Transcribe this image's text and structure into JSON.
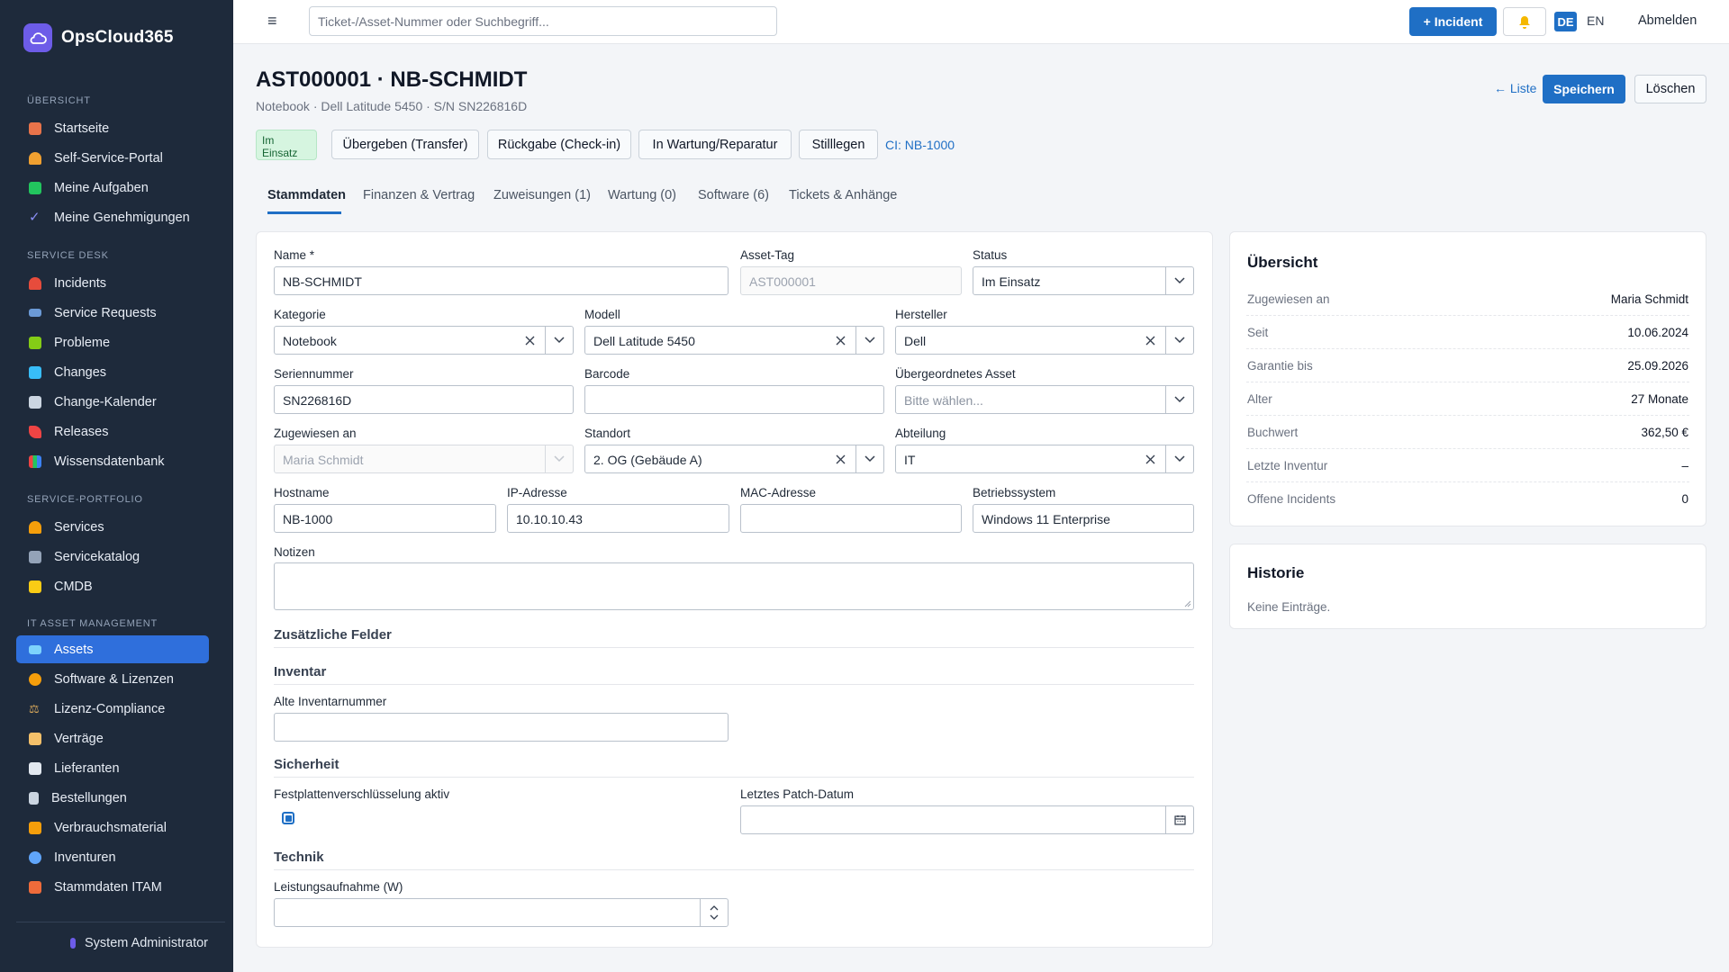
{
  "app": {
    "name": "OpsCloud365"
  },
  "sidebar": {
    "sections": [
      {
        "label": "ÜBERSICHT",
        "items": [
          {
            "label": "Startseite",
            "color": "#e8734a"
          },
          {
            "label": "Self-Service-Portal",
            "color": "#f0a030"
          },
          {
            "label": "Meine Aufgaben",
            "color": "#22c55e"
          },
          {
            "label": "Meine Genehmigungen",
            "color": "#8b8ff5"
          }
        ]
      },
      {
        "label": "SERVICE DESK",
        "items": [
          {
            "label": "Incidents",
            "color": "#e74c3c"
          },
          {
            "label": "Service Requests",
            "color": "#6b9ad6"
          },
          {
            "label": "Probleme",
            "color": "#84cc16"
          },
          {
            "label": "Changes",
            "color": "#38bdf8"
          },
          {
            "label": "Change-Kalender",
            "color": "#cbd5e1"
          },
          {
            "label": "Releases",
            "color": "#ef4444"
          },
          {
            "label": "Wissensdatenbank",
            "color": "#a855f7"
          }
        ]
      },
      {
        "label": "SERVICE-PORTFOLIO",
        "items": [
          {
            "label": "Services",
            "color": "#f59e0b"
          },
          {
            "label": "Servicekatalog",
            "color": "#94a3b8"
          },
          {
            "label": "CMDB",
            "color": "#facc15"
          }
        ]
      },
      {
        "label": "IT ASSET MANAGEMENT",
        "items": [
          {
            "label": "Assets",
            "color": "#38bdf8",
            "active": true
          },
          {
            "label": "Software & Lizenzen",
            "color": "#f59e0b"
          },
          {
            "label": "Lizenz-Compliance",
            "color": "#d4a55a"
          },
          {
            "label": "Verträge",
            "color": "#f4c06a"
          },
          {
            "label": "Lieferanten",
            "color": "#e2e8f0"
          },
          {
            "label": "Bestellungen",
            "color": "#cbd5e1"
          },
          {
            "label": "Verbrauchsmaterial",
            "color": "#f59e0b"
          },
          {
            "label": "Inventuren",
            "color": "#60a5fa"
          },
          {
            "label": "Stammdaten ITAM",
            "color": "#ef6b3a"
          }
        ]
      }
    ],
    "user": "System Administrator"
  },
  "topbar": {
    "search_placeholder": "Ticket-/Asset-Nummer oder Suchbegriff...",
    "incident_button": "+ Incident",
    "lang_de": "DE",
    "lang_en": "EN",
    "logout": "Abmelden"
  },
  "header": {
    "title": "AST000001 · NB-SCHMIDT",
    "subtitle": "Notebook · Dell Latitude 5450 · S/N SN226816D",
    "list_link": "← Liste",
    "save": "Speichern",
    "delete": "Löschen",
    "status_badge": "Im Einsatz",
    "actions": [
      "Übergeben (Transfer)",
      "Rückgabe (Check-in)",
      "In Wartung/Reparatur",
      "Stilllegen"
    ],
    "ci_link": "CI: NB-1000"
  },
  "tabs": [
    "Stammdaten",
    "Finanzen & Vertrag",
    "Zuweisungen (1)",
    "Wartung (0)",
    "Software (6)",
    "Tickets & Anhänge"
  ],
  "form": {
    "name": {
      "label": "Name *",
      "value": "NB-SCHMIDT"
    },
    "asset_tag": {
      "label": "Asset-Tag",
      "value": "AST000001"
    },
    "status": {
      "label": "Status",
      "value": "Im Einsatz"
    },
    "kategorie": {
      "label": "Kategorie",
      "value": "Notebook"
    },
    "modell": {
      "label": "Modell",
      "value": "Dell Latitude 5450"
    },
    "hersteller": {
      "label": "Hersteller",
      "value": "Dell"
    },
    "seriennummer": {
      "label": "Seriennummer",
      "value": "SN226816D"
    },
    "barcode": {
      "label": "Barcode",
      "value": ""
    },
    "parent": {
      "label": "Übergeordnetes Asset",
      "placeholder": "Bitte wählen..."
    },
    "zugewiesen": {
      "label": "Zugewiesen an",
      "value": "Maria Schmidt"
    },
    "standort": {
      "label": "Standort",
      "value": "2. OG (Gebäude A)"
    },
    "abteilung": {
      "label": "Abteilung",
      "value": "IT"
    },
    "hostname": {
      "label": "Hostname",
      "value": "NB-1000"
    },
    "ip": {
      "label": "IP-Adresse",
      "value": "10.10.10.43"
    },
    "mac": {
      "label": "MAC-Adresse",
      "value": ""
    },
    "os": {
      "label": "Betriebssystem",
      "value": "Windows 11 Enterprise"
    },
    "notizen": {
      "label": "Notizen"
    },
    "extra_title": "Zusätzliche Felder",
    "inventar_title": "Inventar",
    "alte_inv": {
      "label": "Alte Inventarnummer"
    },
    "sicherheit_title": "Sicherheit",
    "festplatte": {
      "label": "Festplattenverschlüsselung aktiv"
    },
    "patch": {
      "label": "Letztes Patch-Datum"
    },
    "technik_title": "Technik",
    "leistung": {
      "label": "Leistungsaufnahme (W)"
    }
  },
  "overview": {
    "title": "Übersicht",
    "rows": [
      {
        "key": "Zugewiesen an",
        "value": "Maria Schmidt"
      },
      {
        "key": "Seit",
        "value": "10.06.2024"
      },
      {
        "key": "Garantie bis",
        "value": "25.09.2026"
      },
      {
        "key": "Alter",
        "value": "27 Monate"
      },
      {
        "key": "Buchwert",
        "value": "362,50 €"
      },
      {
        "key": "Letzte Inventur",
        "value": "–"
      },
      {
        "key": "Offene Incidents",
        "value": "0"
      }
    ]
  },
  "history": {
    "title": "Historie",
    "empty": "Keine Einträge."
  }
}
